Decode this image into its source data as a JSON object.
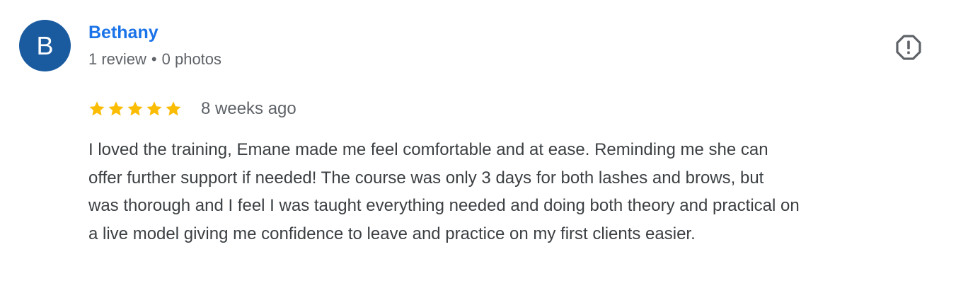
{
  "reviewer": {
    "avatar_letter": "B",
    "name": "Bethany",
    "review_count": "1 review",
    "separator": "•",
    "photo_count": "0 photos"
  },
  "review": {
    "rating": 5,
    "rating_max": 5,
    "date": "8 weeks ago",
    "text_lines": [
      "I loved the training, Emane made me feel comfortable and at ease. Reminding me she can",
      "offer further support if needed! The course was only 3 days for both lashes and brows, but",
      "was thorough and I feel I was taught everything needed and doing both theory and practical on",
      "a live model giving me confidence to leave and practice on my first clients easier."
    ]
  },
  "icons": {
    "report": "report-flag-icon",
    "star": "star-icon"
  },
  "colors": {
    "avatar_bg": "#1a5ba0",
    "name": "#1a73e8",
    "star": "#fbbc04",
    "meta_text": "#5f6368",
    "body_text": "#3c4043",
    "report_icon": "#5f6368"
  }
}
